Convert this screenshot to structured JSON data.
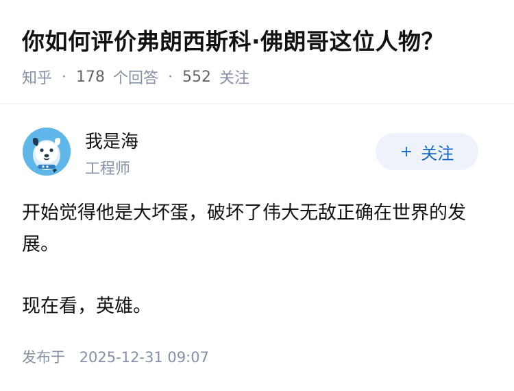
{
  "question": {
    "title": "你如何评价弗朗西斯科·佛朗哥这位人物？",
    "source": "知乎",
    "answer_count": "178",
    "answer_label": "个回答",
    "follower_count": "552",
    "follower_label": "关注",
    "separator": "·"
  },
  "author": {
    "name": "我是海",
    "title": "工程师",
    "avatar_icon": "dog-avatar-icon"
  },
  "follow_button": {
    "icon": "+",
    "label": "关注"
  },
  "answer": {
    "paragraphs": [
      "开始觉得他是大坏蛋，破坏了伟大无敌正确在世界的发展。",
      "现在看，英雄。"
    ]
  },
  "footer": {
    "published_label": "发布于",
    "published_time": "2025-12-31 09:07"
  },
  "colors": {
    "accent": "#1766c1",
    "follow_bg": "#eef3fb",
    "muted": "#8590a6",
    "avatar_bg": "#5fb6e8"
  }
}
